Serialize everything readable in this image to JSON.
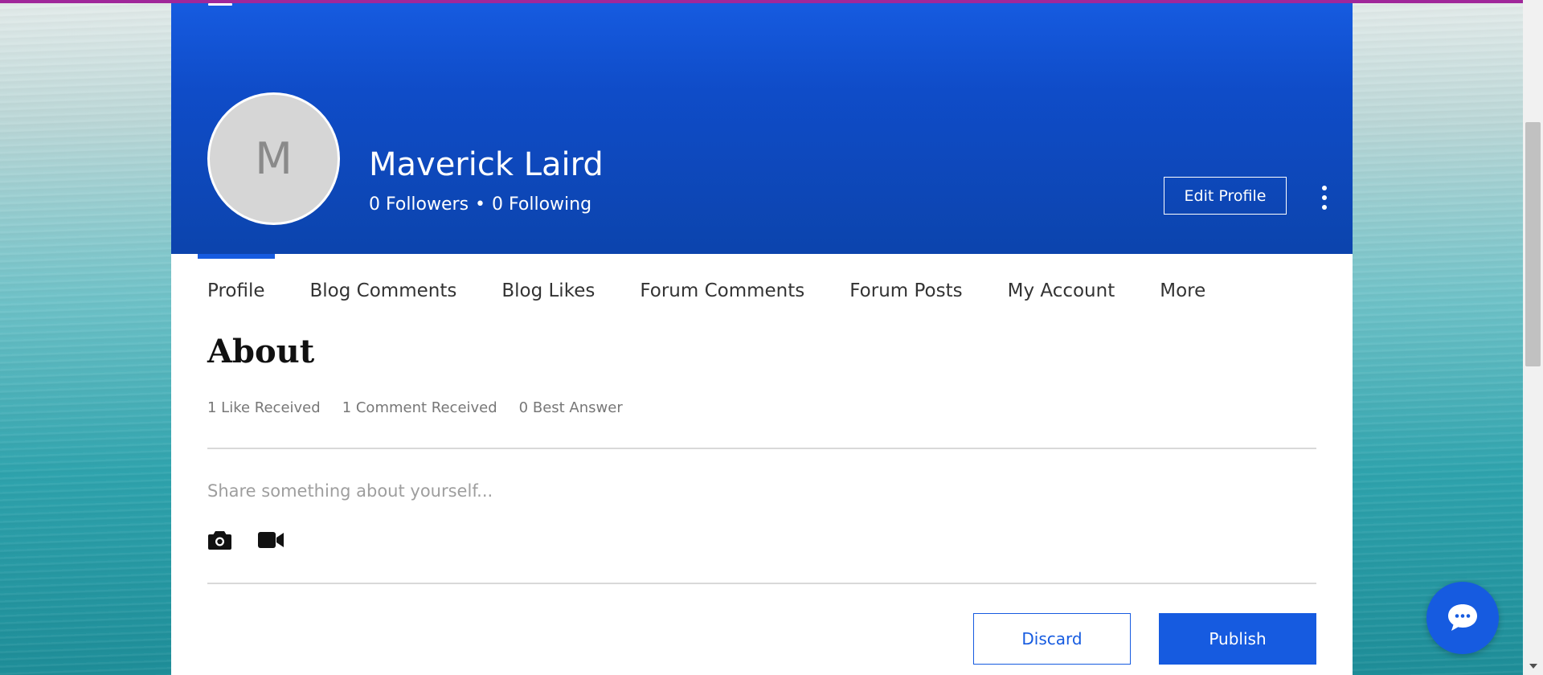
{
  "profile": {
    "avatar_initial": "M",
    "name": "Maverick Laird",
    "followers": "0 Followers",
    "separator": "•",
    "following": "0 Following",
    "edit_label": "Edit Profile"
  },
  "tabs": [
    {
      "label": "Profile",
      "active": true
    },
    {
      "label": "Blog Comments"
    },
    {
      "label": "Blog Likes"
    },
    {
      "label": "Forum Comments"
    },
    {
      "label": "Forum Posts"
    },
    {
      "label": "My Account"
    },
    {
      "label": "More"
    }
  ],
  "about": {
    "title": "About",
    "stats": [
      "1 Like Received",
      "1 Comment Received",
      "0 Best Answer"
    ]
  },
  "composer": {
    "placeholder": "Share something about yourself...",
    "discard_label": "Discard",
    "publish_label": "Publish"
  },
  "icons": {
    "camera": "camera-icon",
    "video": "video-camera-icon",
    "chat": "chat-bubble-icon",
    "more": "more-vertical-icon"
  },
  "colors": {
    "accent": "#165be0",
    "cover_top": "#165be0",
    "cover_bottom": "#0c44ad",
    "top_strip": "#a0279a"
  }
}
